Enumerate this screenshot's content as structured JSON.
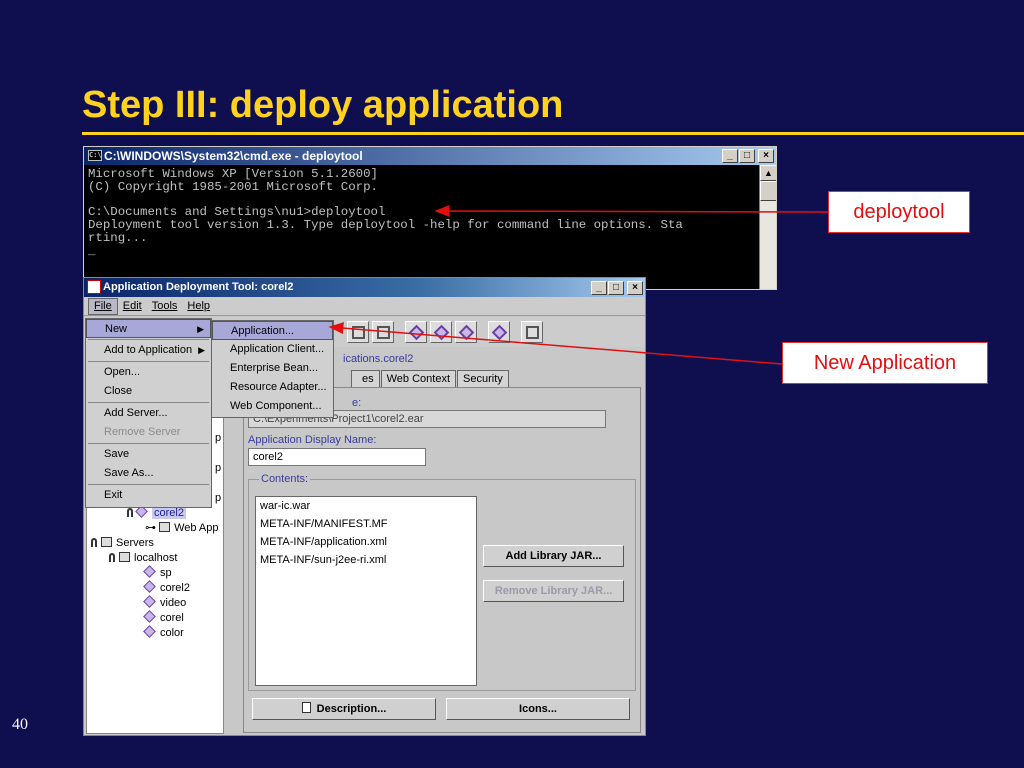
{
  "slide": {
    "title": "Step III: deploy application",
    "number": "40"
  },
  "cmd": {
    "title": "C:\\WINDOWS\\System32\\cmd.exe - deploytool",
    "icon_text": "C:\\",
    "lines": [
      "Microsoft Windows XP [Version 5.1.2600]",
      "(C) Copyright 1985-2001 Microsoft Corp.",
      "",
      "C:\\Documents and Settings\\nu1>deploytool",
      "Deployment tool version 1.3. Type deploytool -help for command line options. Sta",
      "rting...",
      "_"
    ]
  },
  "window_buttons": {
    "minimize": "_",
    "maximize": "□",
    "close": "×"
  },
  "deploy": {
    "title": "Application Deployment Tool: corel2",
    "menubar": {
      "file": "File",
      "edit": "Edit",
      "tools": "Tools",
      "help": "Help"
    },
    "app_name_suffix": "ications.corel2",
    "tabs": [
      "es",
      "Web Context",
      "Security"
    ],
    "fields": {
      "file_name_label_suffix": "e:",
      "file_name_value": "C:\\Experiments\\Project1\\corel2.ear",
      "display_name_label": "Application Display Name:",
      "display_name_value": "corel2",
      "contents_label": "Contents:"
    },
    "contents": [
      "war-ic.war",
      "META-INF/MANIFEST.MF",
      "META-INF/application.xml",
      "META-INF/sun-j2ee-ri.xml"
    ],
    "buttons": {
      "add_library": "Add Library JAR...",
      "remove_library": "Remove Library JAR...",
      "description": "Description...",
      "icons": "Icons..."
    },
    "tree": {
      "partial_p1": "p",
      "partial_p2": "p",
      "partial_p3": "p",
      "selected": "corel2",
      "web_app": "Web App",
      "servers": "Servers",
      "localhost": "localhost",
      "server_apps": [
        "sp",
        "corel2",
        "video",
        "corel",
        "color"
      ]
    }
  },
  "file_menu": {
    "new": "New",
    "add_to_application": "Add to Application",
    "open": "Open...",
    "close": "Close",
    "add_server": "Add Server...",
    "remove_server": "Remove Server",
    "save": "Save",
    "save_as": "Save As...",
    "exit": "Exit"
  },
  "new_submenu": {
    "application": "Application...",
    "application_client": "Application Client...",
    "enterprise_bean": "Enterprise Bean...",
    "resource_adapter": "Resource Adapter...",
    "web_component": "Web Component..."
  },
  "callouts": {
    "deploytool": "deploytool",
    "new_application": "New Application"
  },
  "colors": {
    "background": "#0f0f50",
    "title": "#ffd21f",
    "callout_text": "#e01010",
    "arrow": "#e01010"
  }
}
